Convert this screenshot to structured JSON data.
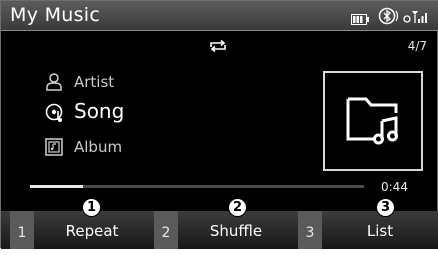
{
  "header": {
    "title": "My Music",
    "icons": [
      "battery-icon",
      "bluetooth-icon",
      "signal-icon"
    ]
  },
  "player": {
    "repeat_mode_icon": "repeat-icon",
    "track_count": "4/7",
    "artist_label": "Artist",
    "song_label": "Song",
    "album_label": "Album",
    "album_art_icon": "music-folder-icon",
    "elapsed_time": "0:44",
    "progress_fraction": 0.16
  },
  "softkeys": [
    {
      "number": "1",
      "label": "Repeat",
      "callout": "1"
    },
    {
      "number": "2",
      "label": "Shuffle",
      "callout": "2"
    },
    {
      "number": "3",
      "label": "List",
      "callout": "3"
    }
  ],
  "colors": {
    "background": "#000000",
    "titlebar": "#4a4a4a",
    "text": "#ffffff",
    "softkey_number_bg": "#5a5a5a"
  }
}
